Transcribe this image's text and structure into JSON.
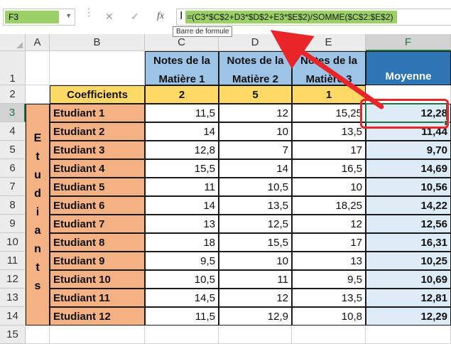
{
  "formula_bar": {
    "namebox": "F3",
    "cancel_icon": "close-icon",
    "enter_icon": "check-icon",
    "fx_label": "fx",
    "formula": "=(C3*$C$2+D3*$D$2+E3*$E$2)/SOMME($C$2:$E$2)",
    "tooltip": "Barre de formule"
  },
  "columns": [
    "A",
    "B",
    "C",
    "D",
    "E",
    "F"
  ],
  "selected_cell": "F3",
  "rows": [
    "1",
    "2",
    "3",
    "4",
    "5",
    "6",
    "7",
    "8",
    "9",
    "10",
    "11",
    "12",
    "13",
    "14",
    "15"
  ],
  "headers": {
    "note1": "Notes de la Matière 1",
    "note2": "Notes de la Matière 2",
    "note3": "Notes de la Matière 3",
    "moyenne": "Moyenne"
  },
  "coefficients": {
    "label": "Coefficients",
    "c": "2",
    "d": "5",
    "e": "1"
  },
  "vertical_label": [
    "E",
    "t",
    "u",
    "d",
    "i",
    "a",
    "n",
    "t",
    "s"
  ],
  "students": [
    {
      "name": "Etudiant 1",
      "c": "11,5",
      "d": "12",
      "e": "15,25",
      "f": "12,28"
    },
    {
      "name": "Etudiant 2",
      "c": "14",
      "d": "10",
      "e": "13,5",
      "f": "11,44"
    },
    {
      "name": "Etudiant 3",
      "c": "12,8",
      "d": "7",
      "e": "17",
      "f": "9,70"
    },
    {
      "name": "Etudiant 4",
      "c": "15,5",
      "d": "14",
      "e": "16,5",
      "f": "14,69"
    },
    {
      "name": "Etudiant 5",
      "c": "11",
      "d": "10,5",
      "e": "10",
      "f": "10,56"
    },
    {
      "name": "Etudiant 6",
      "c": "14",
      "d": "13,5",
      "e": "18,25",
      "f": "14,22"
    },
    {
      "name": "Etudiant 7",
      "c": "13",
      "d": "12,5",
      "e": "12",
      "f": "12,56"
    },
    {
      "name": "Etudiant 8",
      "c": "18",
      "d": "15,5",
      "e": "17",
      "f": "16,31"
    },
    {
      "name": "Etudiant 9",
      "c": "9,5",
      "d": "10",
      "e": "13",
      "f": "10,25"
    },
    {
      "name": "Etudiant 10",
      "c": "10,5",
      "d": "11",
      "e": "9,5",
      "f": "10,69"
    },
    {
      "name": "Etudiant 11",
      "c": "14,5",
      "d": "12",
      "e": "13,5",
      "f": "12,81"
    },
    {
      "name": "Etudiant 12",
      "c": "11,5",
      "d": "12,9",
      "e": "10,8",
      "f": "12,29"
    }
  ],
  "colors": {
    "highlight_green": "#9ad065",
    "student_orange": "#f4b183",
    "notes_blue": "#9dc3e6",
    "moyenne_blue": "#2e75b6",
    "coef_yellow": "#ffd966",
    "result_light_blue": "#ddebf7",
    "annotation_red": "#e8262a",
    "selection_green": "#217346"
  }
}
